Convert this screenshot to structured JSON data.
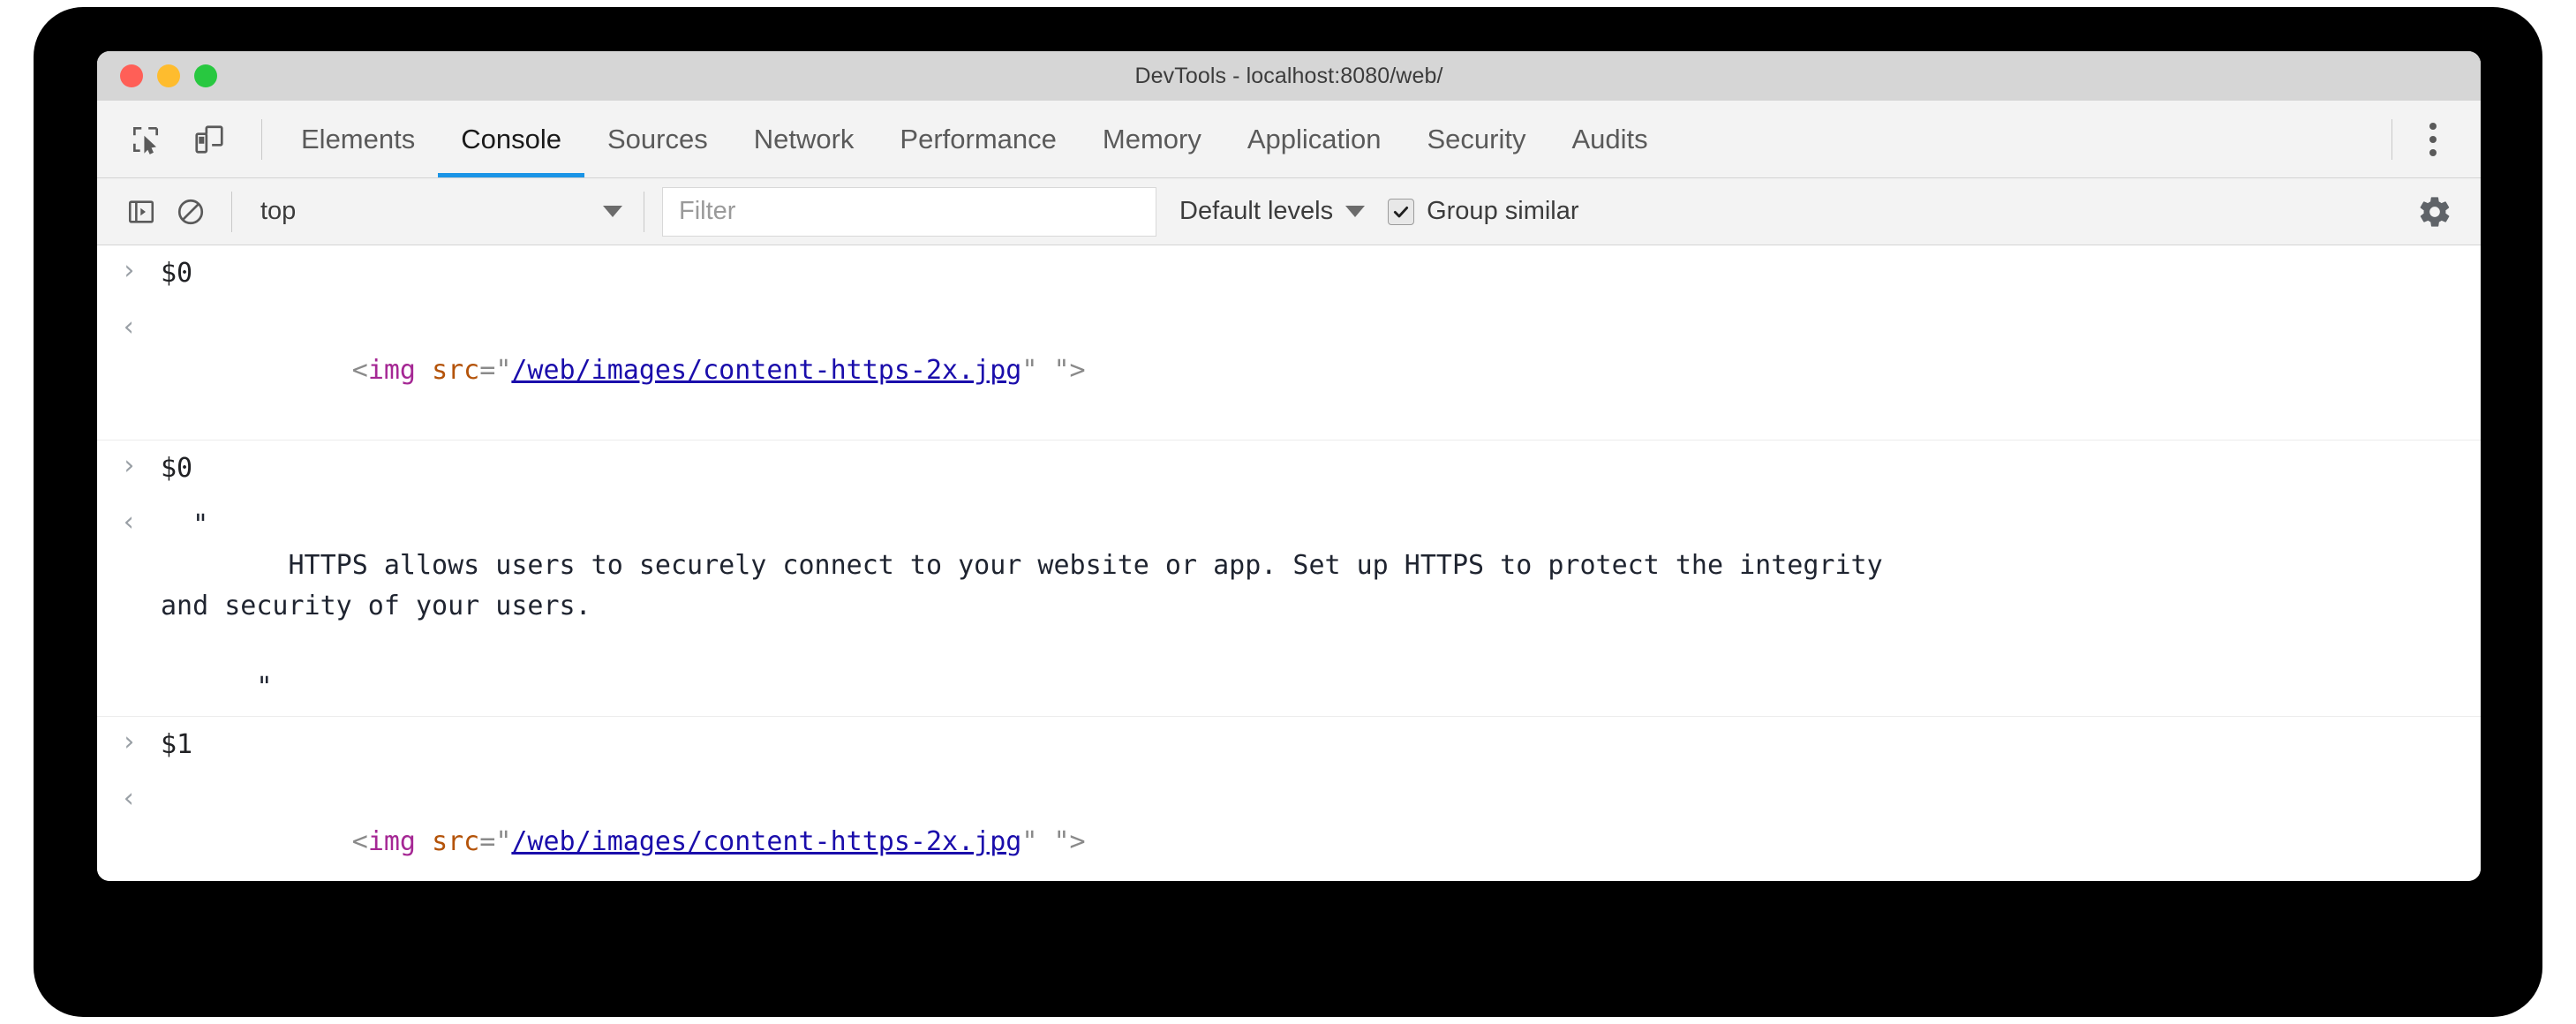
{
  "window": {
    "title": "DevTools - localhost:8080/web/",
    "traffic_lights": [
      {
        "name": "close",
        "color": "#ff5f57"
      },
      {
        "name": "minimize",
        "color": "#febc2e"
      },
      {
        "name": "zoom",
        "color": "#28c840"
      }
    ]
  },
  "toolbar": {
    "inspect_icon": "inspect-element-icon",
    "device_icon": "device-toolbar-icon",
    "menu_icon": "more-options-icon",
    "tabs": [
      {
        "label": "Elements",
        "active": false
      },
      {
        "label": "Console",
        "active": true
      },
      {
        "label": "Sources",
        "active": false
      },
      {
        "label": "Network",
        "active": false
      },
      {
        "label": "Performance",
        "active": false
      },
      {
        "label": "Memory",
        "active": false
      },
      {
        "label": "Application",
        "active": false
      },
      {
        "label": "Security",
        "active": false
      },
      {
        "label": "Audits",
        "active": false
      }
    ],
    "active_tab": "Console",
    "accent_color": "#1a94e6"
  },
  "console_toolbar": {
    "sidebar_toggle_icon": "console-sidebar-icon",
    "clear_icon": "clear-console-icon",
    "context": "top",
    "filter_placeholder": "Filter",
    "filter_value": "",
    "levels_label": "Default levels",
    "group_similar_label": "Group similar",
    "group_similar_checked": true,
    "settings_icon": "gear-icon"
  },
  "console": {
    "input_marker": "›",
    "output_marker": "‹",
    "prompt_marker": "›",
    "groups": [
      {
        "input": "$0",
        "output_type": "html",
        "output": {
          "open": "<",
          "tag": "img",
          "space": " ",
          "attr": "src",
          "eq": "=",
          "quote_open": "\"",
          "link": "/web/images/content-https-2x.jpg",
          "quote_close": "\"",
          "trailing": " \"",
          "close": ">"
        }
      },
      {
        "input": "$0",
        "output_type": "string",
        "output": {
          "open_quote": "\"",
          "line1": "        HTTPS allows users to securely connect to your website or app. Set up HTTPS to protect the integrity",
          "line2": "and security of your users.",
          "close_quote": "\""
        }
      },
      {
        "input": "$1",
        "output_type": "html",
        "output": {
          "open": "<",
          "tag": "img",
          "space": " ",
          "attr": "src",
          "eq": "=",
          "quote_open": "\"",
          "link": "/web/images/content-https-2x.jpg",
          "quote_close": "\"",
          "trailing": " \"",
          "close": ">"
        }
      }
    ],
    "prompt_value": ""
  }
}
